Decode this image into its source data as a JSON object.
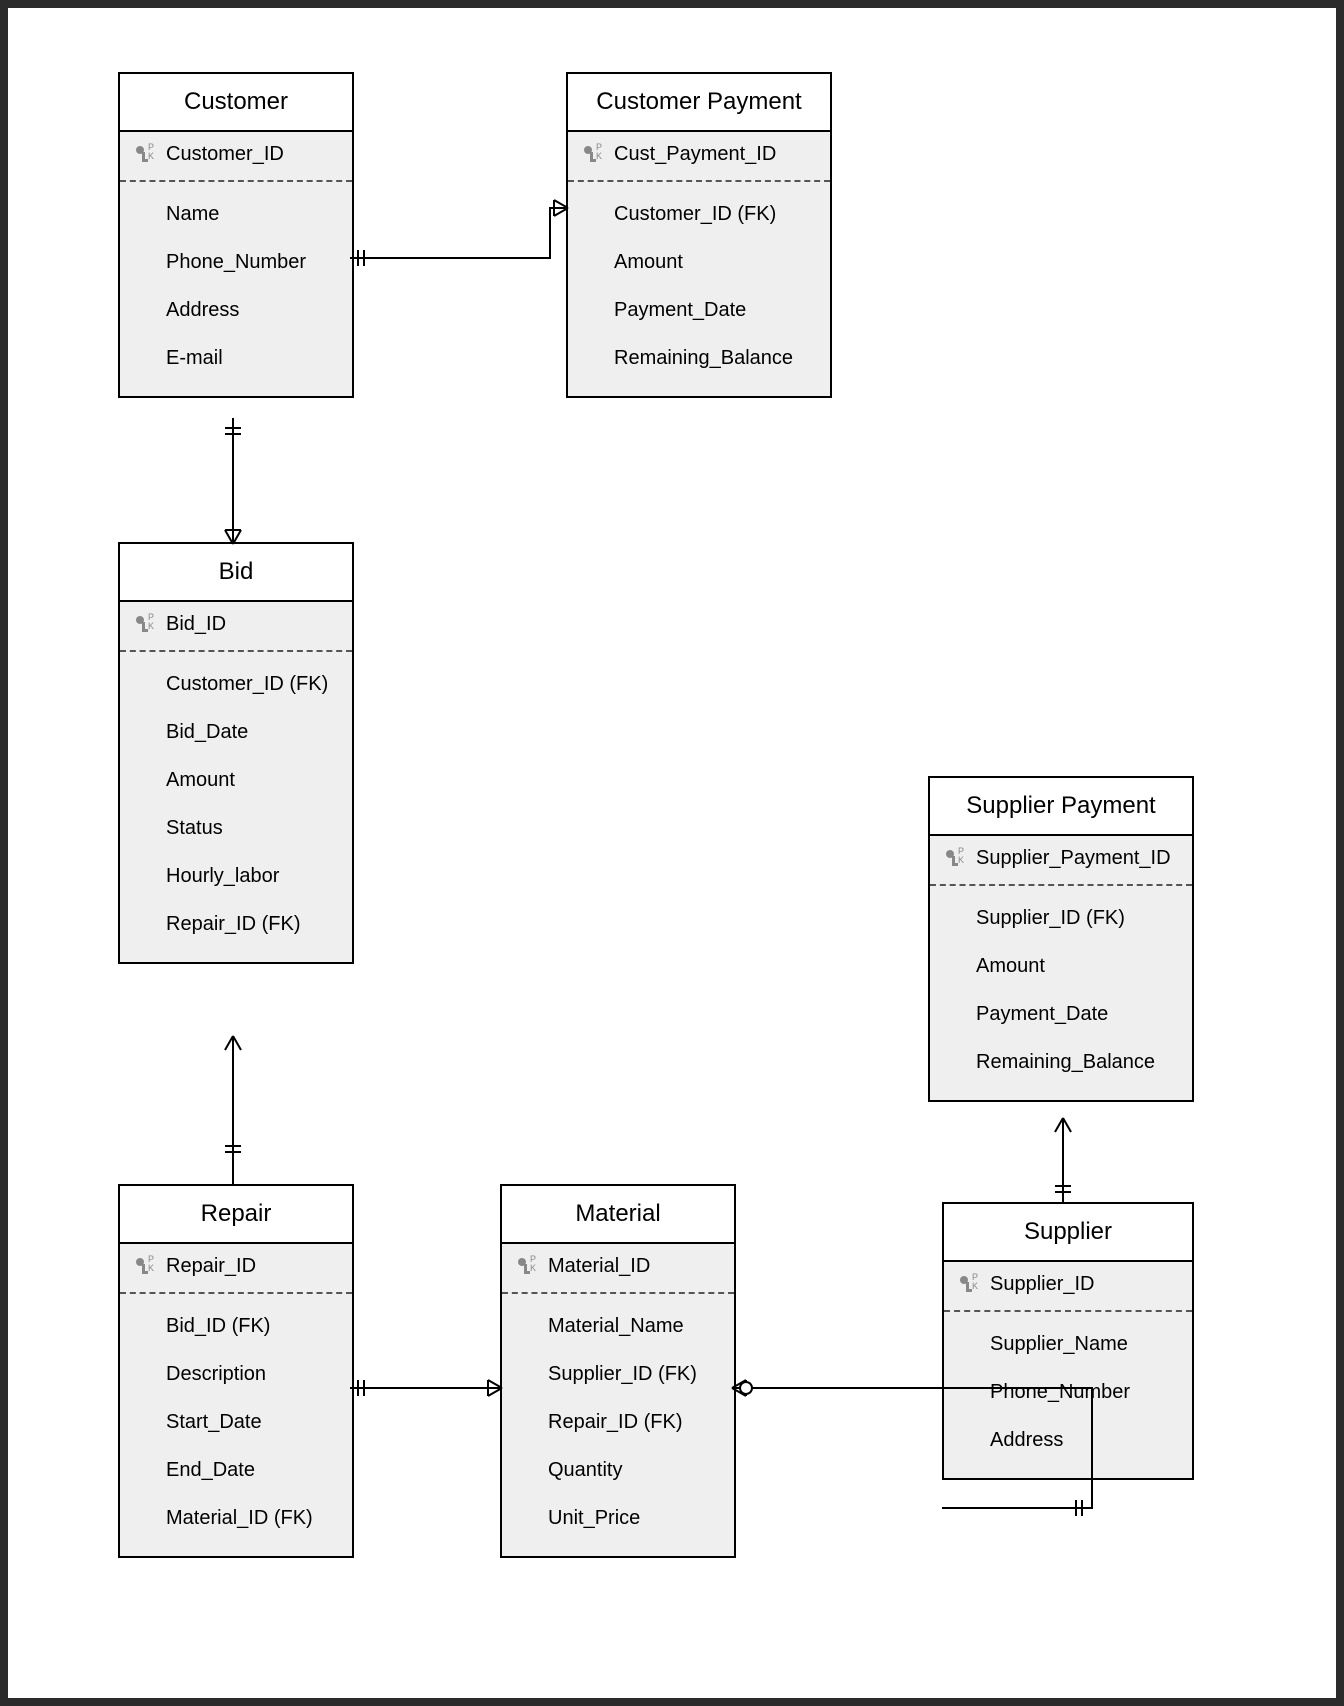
{
  "entities": {
    "customer": {
      "title": "Customer",
      "pk": "Customer_ID",
      "attrs": [
        "Name",
        "Phone_Number",
        "Address",
        "E-mail"
      ]
    },
    "customer_payment": {
      "title": "Customer Payment",
      "pk": "Cust_Payment_ID",
      "attrs": [
        "Customer_ID (FK)",
        "Amount",
        "Payment_Date",
        "Remaining_Balance"
      ]
    },
    "bid": {
      "title": "Bid",
      "pk": "Bid_ID",
      "attrs": [
        "Customer_ID (FK)",
        "Bid_Date",
        "Amount",
        "Status",
        "Hourly_labor",
        "Repair_ID (FK)"
      ]
    },
    "repair": {
      "title": "Repair",
      "pk": "Repair_ID",
      "attrs": [
        "Bid_ID (FK)",
        "Description",
        "Start_Date",
        "End_Date",
        "Material_ID (FK)"
      ]
    },
    "material": {
      "title": "Material",
      "pk": "Material_ID",
      "attrs": [
        "Material_Name",
        "Supplier_ID (FK)",
        "Repair_ID (FK)",
        "Quantity",
        "Unit_Price"
      ]
    },
    "supplier_payment": {
      "title": "Supplier Payment",
      "pk": "Supplier_Payment_ID",
      "attrs": [
        "Supplier_ID (FK)",
        "Amount",
        "Payment_Date",
        "Remaining_Balance"
      ]
    },
    "supplier": {
      "title": "Supplier",
      "pk": "Supplier_ID",
      "attrs": [
        "Supplier_Name",
        "Phone_Number",
        "Address"
      ]
    }
  },
  "chart_data": {
    "type": "diagram",
    "diagram_type": "entity-relationship",
    "entities": [
      {
        "name": "Customer",
        "primary_key": "Customer_ID",
        "attributes": [
          "Name",
          "Phone_Number",
          "Address",
          "E-mail"
        ]
      },
      {
        "name": "Customer Payment",
        "primary_key": "Cust_Payment_ID",
        "attributes": [
          "Customer_ID (FK)",
          "Amount",
          "Payment_Date",
          "Remaining_Balance"
        ]
      },
      {
        "name": "Bid",
        "primary_key": "Bid_ID",
        "attributes": [
          "Customer_ID (FK)",
          "Bid_Date",
          "Amount",
          "Status",
          "Hourly_labor",
          "Repair_ID (FK)"
        ]
      },
      {
        "name": "Repair",
        "primary_key": "Repair_ID",
        "attributes": [
          "Bid_ID (FK)",
          "Description",
          "Start_Date",
          "End_Date",
          "Material_ID (FK)"
        ]
      },
      {
        "name": "Material",
        "primary_key": "Material_ID",
        "attributes": [
          "Material_Name",
          "Supplier_ID (FK)",
          "Repair_ID (FK)",
          "Quantity",
          "Unit_Price"
        ]
      },
      {
        "name": "Supplier Payment",
        "primary_key": "Supplier_Payment_ID",
        "attributes": [
          "Supplier_ID (FK)",
          "Amount",
          "Payment_Date",
          "Remaining_Balance"
        ]
      },
      {
        "name": "Supplier",
        "primary_key": "Supplier_ID",
        "attributes": [
          "Supplier_Name",
          "Phone_Number",
          "Address"
        ]
      }
    ],
    "relationships": [
      {
        "from": "Customer",
        "to": "Customer Payment",
        "cardinality": "1..N"
      },
      {
        "from": "Customer",
        "to": "Bid",
        "cardinality": "1..N"
      },
      {
        "from": "Bid",
        "to": "Repair",
        "cardinality": "1..1"
      },
      {
        "from": "Repair",
        "to": "Material",
        "cardinality": "1..N"
      },
      {
        "from": "Supplier",
        "to": "Material",
        "cardinality": "1..N"
      },
      {
        "from": "Supplier",
        "to": "Supplier Payment",
        "cardinality": "1..N"
      }
    ]
  }
}
